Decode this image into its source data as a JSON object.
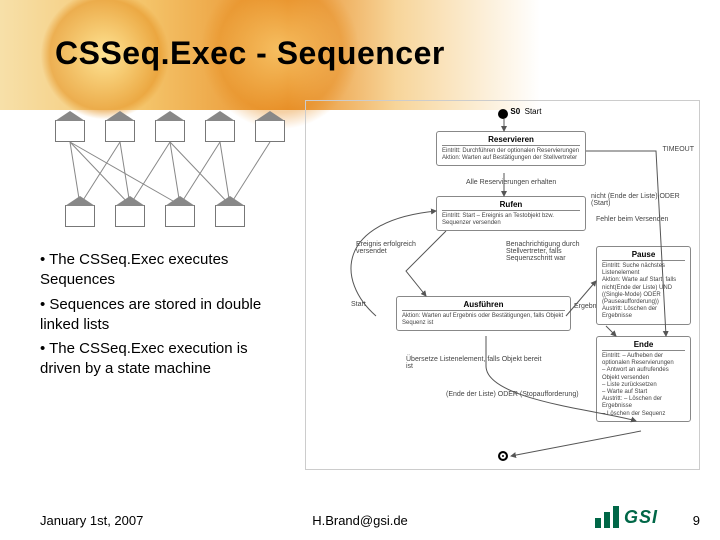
{
  "title": "CSSeq.Exec - Sequencer",
  "bullets": {
    "b1": "• The CSSeq.Exec executes Sequences",
    "b2": "• Sequences are stored in double linked lists",
    "b3": "• The CSSeq.Exec execution is driven by a state machine"
  },
  "state": {
    "start_label": "S0",
    "start_text": "Start",
    "reservieren": {
      "title": "Reservieren",
      "l1": "Eintritt:  Durchführen der optionalen Reservierungen",
      "l2": "Aktion:   Warten auf Bestätigungen der Stellvertreter"
    },
    "res_exit": "Alle Reservierungen erhalten",
    "timeout": "TIMEOUT",
    "rufen": {
      "title": "Rufen",
      "l1": "Eintritt:  Start – Ereignis an Testobjekt bzw. Sequenzer versenden"
    },
    "ruf_left": "Ereignis erfolgreich versendet",
    "ruf_right1": "nicht (Ende der Liste) ODER (Start)",
    "ruf_right2": "Fehler beim Versenden",
    "ruf_right3": "Benachrichtigung durch Stellvertreter, falls Sequenzschritt war",
    "start_side": "Start",
    "ausfuehren": {
      "title": "Ausführen",
      "l1": "Aktion:  Warten auf Ergebnis oder Bestätigungen, falls Objekt Sequenz ist"
    },
    "aus_right": "Ergebnis",
    "aus_below1": "Übersetze Listenelement, falls Objekt bereit ist",
    "aus_below2": "(Ende der Liste) ODER (Stopaufforderung)",
    "pause": {
      "title": "Pause",
      "l1": "Eintritt: Suche nächstes Listenelement",
      "l2": "Aktion:  Warte auf Start, falls nicht(Ende der Liste) UND ((Single-Mode) ODER (Pauseaufforderung))",
      "l3": "Austritt: Löschen der Ergebnisse"
    },
    "ende": {
      "title": "Ende",
      "l1": "Eintritt: – Aufheben der optionalen Reservierungen",
      "l2": "            – Antwort an aufrufendes Objekt versenden",
      "l3": "            – Liste zurücksetzen",
      "l4": "            – Warte auf Start",
      "l5": "Austritt: – Löschen der Ergebnisse",
      "l6": "            – Löschen der Sequenz"
    }
  },
  "footer": {
    "date": "January 1st, 2007",
    "email": "H.Brand@gsi.de",
    "logo": "GSI",
    "page": "9"
  }
}
